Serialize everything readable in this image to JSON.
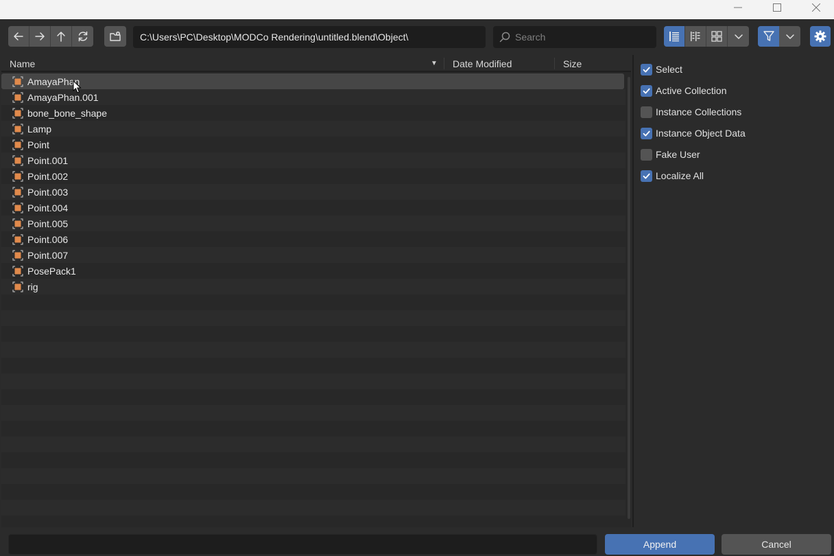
{
  "toolbar": {
    "path": "C:\\Users\\PC\\Desktop\\MODCo Rendering\\untitled.blend\\Object\\",
    "search_placeholder": "Search"
  },
  "columns": {
    "name": "Name",
    "sort_indicator": "▼",
    "date_modified": "Date Modified",
    "size": "Size"
  },
  "files": [
    "AmayaPhan",
    "AmayaPhan.001",
    "bone_bone_shape",
    "Lamp",
    "Point",
    "Point.001",
    "Point.002",
    "Point.003",
    "Point.004",
    "Point.005",
    "Point.006",
    "Point.007",
    "PosePack1",
    "rig"
  ],
  "options": [
    {
      "label": "Select",
      "checked": true
    },
    {
      "label": "Active Collection",
      "checked": true
    },
    {
      "label": "Instance Collections",
      "checked": false
    },
    {
      "label": "Instance Object Data",
      "checked": true
    },
    {
      "label": "Fake User",
      "checked": false
    },
    {
      "label": "Localize All",
      "checked": true
    }
  ],
  "bottom": {
    "filename_value": "",
    "append_label": "Append",
    "cancel_label": "Cancel"
  },
  "colors": {
    "accent": "#4772b3",
    "object_icon": "#e08a4c"
  },
  "icons": {
    "back": "arrow-left-icon",
    "forward": "arrow-right-icon",
    "parent": "arrow-up-icon",
    "refresh": "refresh-icon",
    "new_folder": "new-folder-icon",
    "search": "search-icon",
    "view_vertical": "vertical-list-icon",
    "view_horizontal": "horizontal-list-icon",
    "view_thumbnails": "thumbnails-icon",
    "filter": "filter-icon",
    "settings": "gear-icon",
    "object": "object-icon"
  }
}
